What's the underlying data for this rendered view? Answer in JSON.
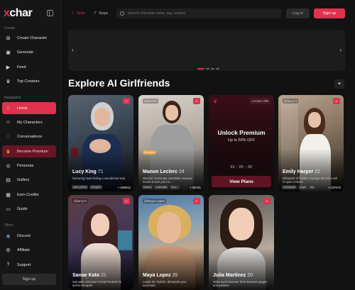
{
  "app": {
    "logo_x": "x",
    "logo_rest": "char"
  },
  "sidebar": {
    "create_label": "Create",
    "create_items": [
      {
        "label": "Create Character",
        "icon": "plus-square-icon"
      },
      {
        "label": "Generate",
        "icon": "image-icon"
      },
      {
        "label": "Feed",
        "icon": "play-icon"
      },
      {
        "label": "Top Creators",
        "icon": "trophy-icon"
      }
    ],
    "navigation_label": "Navigation",
    "nav_items": [
      {
        "label": "Home",
        "icon": "home-icon",
        "state": "active"
      },
      {
        "label": "My Characters",
        "icon": "user-icon"
      },
      {
        "label": "Conversations",
        "icon": "chat-icon"
      },
      {
        "label": "Become Premium",
        "icon": "crown-icon",
        "state": "premium"
      },
      {
        "label": "Personas",
        "icon": "persona-icon"
      },
      {
        "label": "Gallery",
        "icon": "gallery-icon"
      },
      {
        "label": "Earn Credits",
        "icon": "credits-icon"
      },
      {
        "label": "Guide",
        "icon": "book-icon"
      }
    ],
    "other_label": "Other",
    "other_items": [
      {
        "label": "Discord",
        "icon": "discord-icon"
      },
      {
        "label": "Affiliate",
        "icon": "affiliate-icon"
      },
      {
        "label": "Support",
        "icon": "support-icon"
      }
    ],
    "signup_label": "Sign up"
  },
  "topbar": {
    "girls_label": "Girls",
    "guys_label": "Guys",
    "search_placeholder": "Search character name, tag, content",
    "login_label": "Log in",
    "signup_label": "Sign up"
  },
  "carousel": {
    "active_dot": 1,
    "dots": 4
  },
  "main": {
    "title": "Explore AI Girlfriends"
  },
  "cards": [
    {
      "name": "Lucy King",
      "age": "71",
      "handle": "",
      "desc": "Nurturing heart hiding a wanderlust soul",
      "tags": [
        "older-parent",
        "caregiver"
      ],
      "count": "190913"
    },
    {
      "name": "Manon Leclerc",
      "age": "24",
      "handle": "@lerci20",
      "desc": "Student roommate overlooks massive needs to lure you int...",
      "tags": [
        "student",
        "roommate",
        "tsun..."
      ],
      "count": "46721",
      "badge": "Exclusive"
    },
    {
      "name": "Emily Harper",
      "age": "22",
      "handle": "@larry71",
      "desc": "Whispers of hidden cravings behind a veil of quiet reserve",
      "tags": [
        "submissive",
        "virgin",
        "shy"
      ],
      "count": "137072"
    },
    {
      "name": "Sanae Kato",
      "age": "21",
      "handle": "@larry71",
      "desc": "Sarcastic streamer's heart hooked on anime escapes",
      "tags": [],
      "count": ""
    },
    {
      "name": "Maya Lopez",
      "age": "35",
      "handle": "@Maya Lopez",
      "desc": "Leads the rhythm, demands your surrender.",
      "tags": [],
      "count": ""
    },
    {
      "name": "Julia Martinez",
      "age": "20",
      "handle": "",
      "desc": "Wide-eyed dreamer feels between pages and passion",
      "tags": [],
      "count": ""
    }
  ],
  "premium": {
    "limited_label": "Limited offer",
    "title": "Unlock Premium",
    "subtitle": "Up to 50% OFF",
    "timer": "02 : 05 : 00",
    "button_label": "View Plans"
  },
  "colors": {
    "accent": "#e0324e",
    "background": "#121212",
    "sidebar": "#161616"
  }
}
